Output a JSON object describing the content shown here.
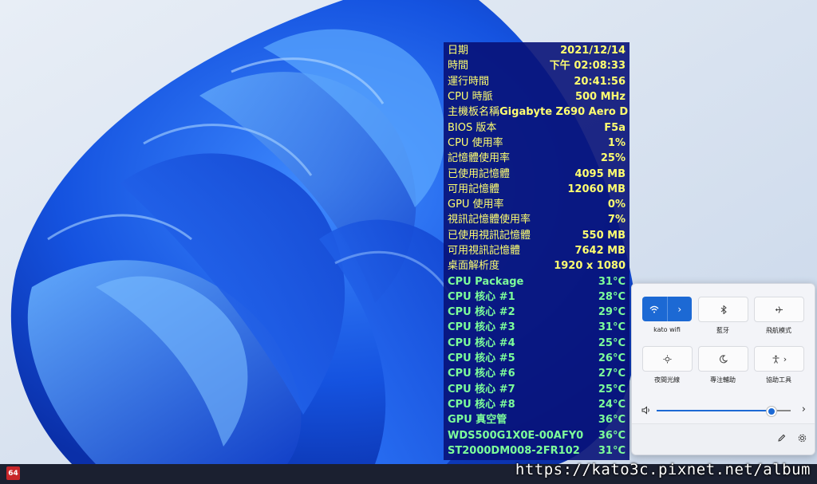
{
  "monitor": {
    "rows": [
      {
        "label": "日期",
        "value": "2021/12/14",
        "style": "y"
      },
      {
        "label": "時間",
        "value": "下午 02:08:33",
        "style": "y"
      },
      {
        "label": "運行時間",
        "value": "20:41:56",
        "style": "y"
      },
      {
        "label": "CPU 時脈",
        "value": "500 MHz",
        "style": "y"
      },
      {
        "label": "主機板名稱",
        "value": "Gigabyte Z690 Aero D",
        "style": "y"
      },
      {
        "label": "BIOS 版本",
        "value": "F5a",
        "style": "y"
      },
      {
        "label": "CPU 使用率",
        "value": "1%",
        "style": "y"
      },
      {
        "label": "記憶體使用率",
        "value": "25%",
        "style": "y"
      },
      {
        "label": "已使用記憶體",
        "value": "4095 MB",
        "style": "y"
      },
      {
        "label": "可用記憶體",
        "value": "12060 MB",
        "style": "y"
      },
      {
        "label": "GPU 使用率",
        "value": "0%",
        "style": "y"
      },
      {
        "label": "視訊記憶體使用率",
        "value": "7%",
        "style": "y"
      },
      {
        "label": "已使用視訊記憶體",
        "value": "550 MB",
        "style": "y"
      },
      {
        "label": "可用視訊記憶體",
        "value": "7642 MB",
        "style": "y"
      },
      {
        "label": "桌面解析度",
        "value": "1920 x 1080",
        "style": "y"
      },
      {
        "label": "CPU Package",
        "value": "31°C",
        "style": "g"
      },
      {
        "label": "CPU 核心 #1",
        "value": "28°C",
        "style": "g"
      },
      {
        "label": "CPU 核心 #2",
        "value": "29°C",
        "style": "g"
      },
      {
        "label": "CPU 核心 #3",
        "value": "31°C",
        "style": "g"
      },
      {
        "label": "CPU 核心 #4",
        "value": "25°C",
        "style": "g"
      },
      {
        "label": "CPU 核心 #5",
        "value": "26°C",
        "style": "g"
      },
      {
        "label": "CPU 核心 #6",
        "value": "27°C",
        "style": "g"
      },
      {
        "label": "CPU 核心 #7",
        "value": "25°C",
        "style": "g"
      },
      {
        "label": "CPU 核心 #8",
        "value": "24°C",
        "style": "g"
      },
      {
        "label": "GPU 真空管",
        "value": "36°C",
        "style": "g"
      },
      {
        "label": "WDS500G1X0E-00AFY0",
        "value": "36°C",
        "style": "g"
      },
      {
        "label": "ST2000DM008-2FR102",
        "value": "31°C",
        "style": "g"
      }
    ],
    "colors": {
      "background": "#08127a",
      "primary": "#ffff70",
      "temperature": "#7dff9a"
    }
  },
  "quick_settings": {
    "wifi_label": "kato wifi",
    "bluetooth_label": "藍牙",
    "airplane_label": "飛航模式",
    "night_light_label": "夜間光線",
    "focus_label": "專注輔助",
    "accessibility_label": "協助工具",
    "volume_level": 0.86,
    "accent": "#1c69d4"
  },
  "taskbar": {
    "tray_badge": "64"
  },
  "watermark": "https://kato3c.pixnet.net/album"
}
